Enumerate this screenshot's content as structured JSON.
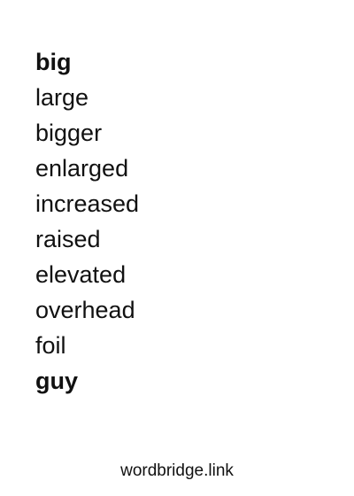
{
  "words": [
    {
      "text": "big",
      "bold": true
    },
    {
      "text": "large",
      "bold": false
    },
    {
      "text": "bigger",
      "bold": false
    },
    {
      "text": "enlarged",
      "bold": false
    },
    {
      "text": "increased",
      "bold": false
    },
    {
      "text": "raised",
      "bold": false
    },
    {
      "text": "elevated",
      "bold": false
    },
    {
      "text": "overhead",
      "bold": false
    },
    {
      "text": "foil",
      "bold": false
    },
    {
      "text": "guy",
      "bold": true
    }
  ],
  "footer": {
    "site": "wordbridge.link"
  }
}
